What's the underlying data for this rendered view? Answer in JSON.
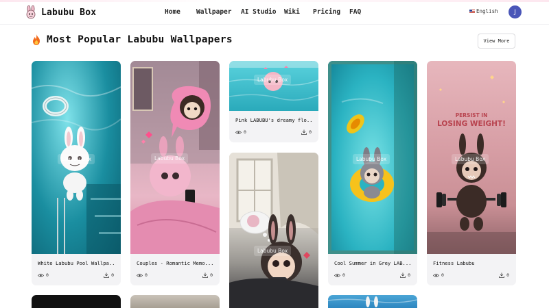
{
  "header": {
    "brand": "Labubu Box",
    "nav": [
      "Home",
      "Wallpaper",
      "AI Studio",
      "Wiki",
      "Pricing",
      "FAQ"
    ],
    "language": "English",
    "avatar_initial": "J"
  },
  "section": {
    "title": "Most Popular Labubu Wallpapers",
    "view_more": "View More"
  },
  "watermark": "Labubu Box",
  "cards": [
    {
      "title": "White Labubu Pool Wallpa...",
      "views": "0",
      "downloads": "0"
    },
    {
      "title": "Couples - Romantic Memo...",
      "views": "0",
      "downloads": "0"
    },
    {
      "title": "Pink LABUBU's dreamy flo...",
      "views": "0",
      "downloads": "0"
    },
    {
      "title": "Cool Summer in Grey LAB...",
      "views": "0",
      "downloads": "0"
    },
    {
      "title": "Fitness Labubu",
      "views": "0",
      "downloads": "0"
    }
  ],
  "poster_text": [
    "PERSIST IN",
    "LOSING WEIGHT!"
  ],
  "icons": {
    "logo": "labubu-logo-icon",
    "section": "fire-icon",
    "views": "eye-icon",
    "downloads": "download-icon",
    "language": "us-flag-icon"
  },
  "colors": {
    "avatar": "#4a56b8",
    "card_bg": "#f3f3f5"
  }
}
